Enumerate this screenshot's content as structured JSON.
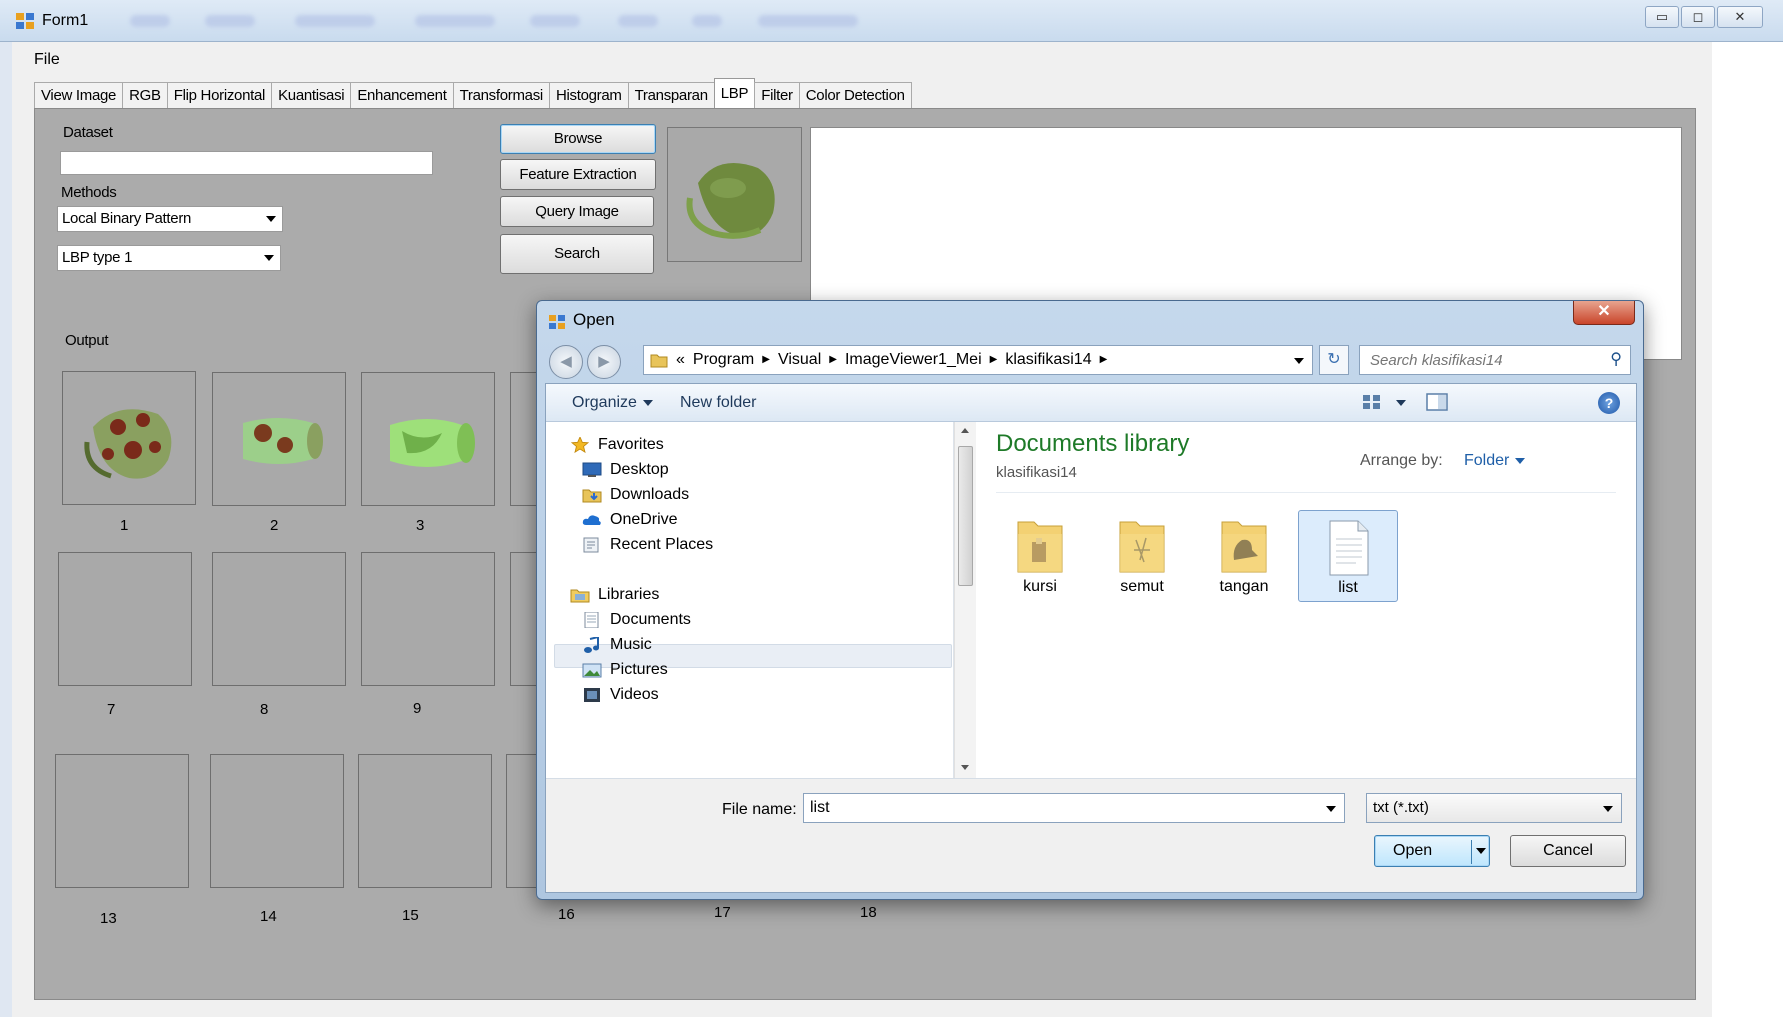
{
  "window": {
    "title": "Form1",
    "controls": {
      "minimize": "▭",
      "maximize": "◻",
      "close": "✕"
    }
  },
  "menu": {
    "file": "File"
  },
  "tabs": [
    "View Image",
    "RGB",
    "Flip Horizontal",
    "Kuantisasi",
    "Enhancement",
    "Transformasi",
    "Histogram",
    "Transparan",
    "LBP",
    "Filter",
    "Color Detection"
  ],
  "active_tab": "LBP",
  "lbp": {
    "dataset_label": "Dataset",
    "dataset_value": "",
    "methods_label": "Methods",
    "method_value": "Local Binary Pattern",
    "type_value": "LBP type 1",
    "browse": "Browse",
    "feature_extraction": "Feature Extraction",
    "query_image": "Query Image",
    "search": "Search",
    "output_label": "Output",
    "thumb_numbers": [
      "1",
      "2",
      "3",
      "7",
      "8",
      "9",
      "13",
      "14",
      "15",
      "16",
      "17",
      "18"
    ]
  },
  "dialog": {
    "title": "Open",
    "close": "✕",
    "back": "◀",
    "forward": "▶",
    "path_prefix": "«",
    "path": [
      "Program",
      "Visual",
      "ImageViewer1_Mei",
      "klasifikasi14"
    ],
    "search_placeholder": "Search klasifikasi14",
    "refresh": "↻",
    "organize": "Organize",
    "new_folder": "New folder",
    "help": "?",
    "nav": {
      "favorites": "Favorites",
      "desktop": "Desktop",
      "downloads": "Downloads",
      "onedrive": "OneDrive",
      "recent": "Recent Places",
      "libraries": "Libraries",
      "documents": "Documents",
      "music": "Music",
      "pictures": "Pictures",
      "videos": "Videos"
    },
    "library_title": "Documents library",
    "library_sub": "klasifikasi14",
    "arrange_by": "Arrange by:",
    "arrange_value": "Folder",
    "items": [
      "kursi",
      "semut",
      "tangan",
      "list"
    ],
    "selected_item": "list",
    "file_name_label": "File name:",
    "file_name_value": "list",
    "file_type": "txt (*.txt)",
    "open": "Open",
    "cancel": "Cancel"
  },
  "colors": {
    "panel_bg": "#ababab",
    "library_title": "#1e7a28",
    "link_blue": "#1f5fa8",
    "selection": "#dcecfc"
  }
}
